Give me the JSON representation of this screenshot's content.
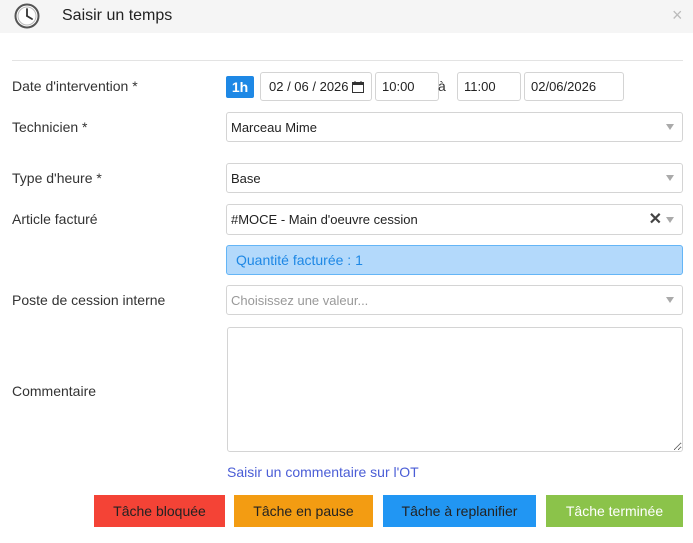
{
  "header": {
    "title": "Saisir un temps",
    "close_label": "×"
  },
  "form": {
    "date": {
      "label": "Date d'intervention *",
      "duration_badge": "1h",
      "date_value": "02 / 06 / 2026",
      "start_time": "10:00",
      "separator": "à",
      "end_time": "11:00",
      "end_date": "02/06/2026"
    },
    "technicien": {
      "label": "Technicien *",
      "value": "Marceau Mime"
    },
    "type_heure": {
      "label": "Type d'heure *",
      "value": "Base"
    },
    "article": {
      "label": "Article facturé",
      "value": "#MOCE - Main d'oeuvre cession",
      "clear": "✕"
    },
    "quantite": "Quantité facturée : 1",
    "poste": {
      "label": "Poste de cession interne",
      "placeholder": "Choisissez une valeur..."
    },
    "commentaire": {
      "label": "Commentaire",
      "value": ""
    },
    "comment_link": "Saisir un commentaire sur l'OT"
  },
  "actions": {
    "blocked": "Tâche bloquée",
    "paused": "Tâche en pause",
    "reschedule": "Tâche à replanifier",
    "done": "Tâche terminée"
  },
  "colors": {
    "accent": "#1e88e5",
    "red": "#f44336",
    "orange": "#f39c12",
    "blue": "#2196f3",
    "green": "#8bc34a"
  }
}
